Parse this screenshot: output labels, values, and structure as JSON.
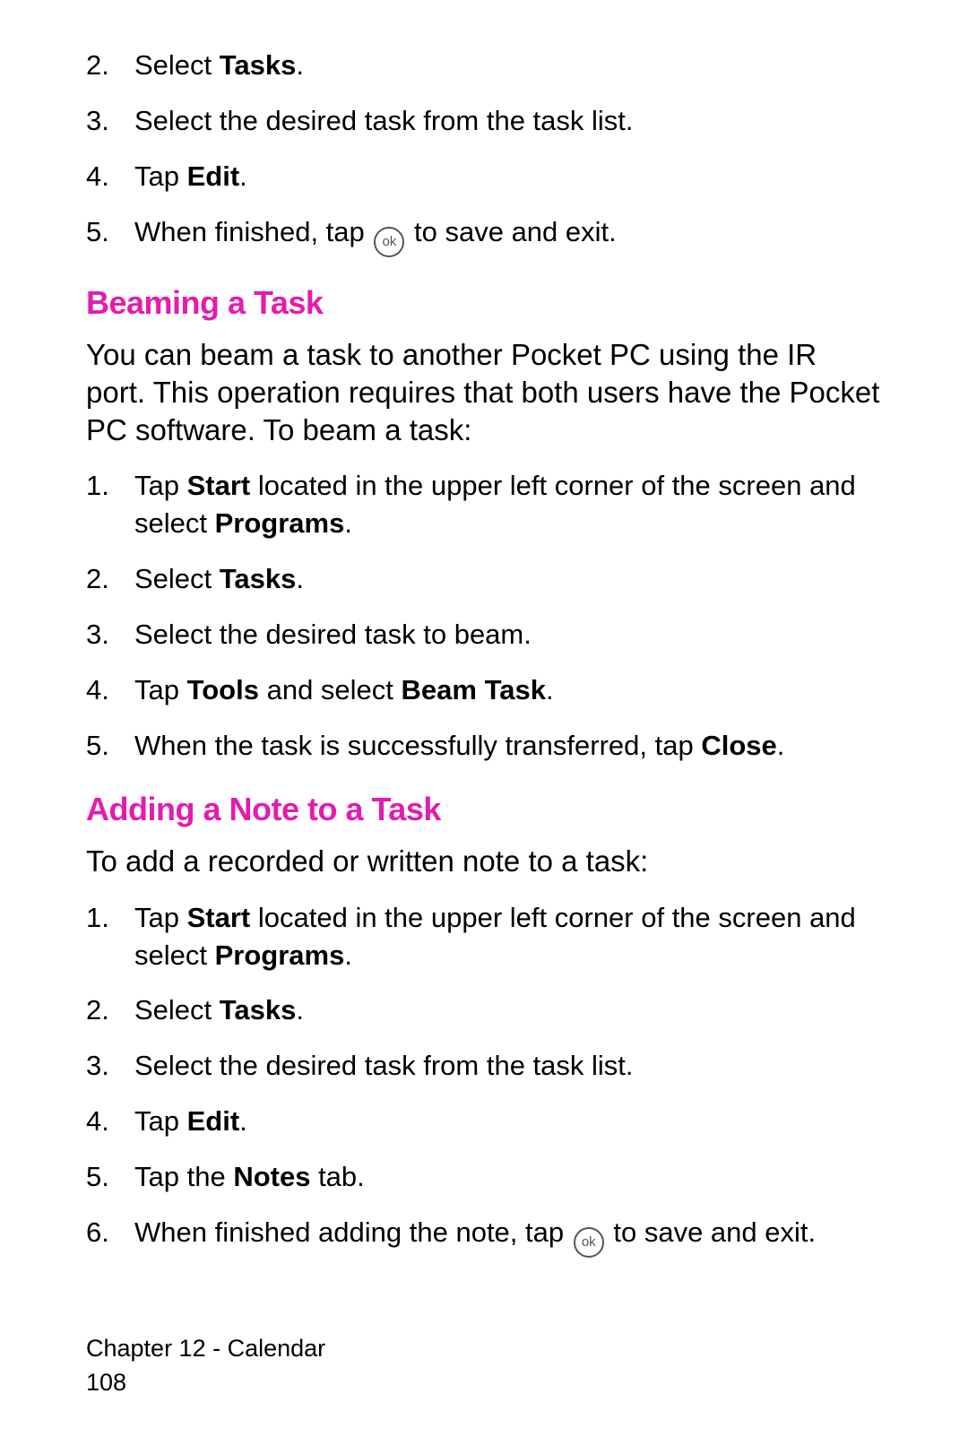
{
  "top_steps": [
    {
      "num": "2.",
      "parts": [
        {
          "t": "Select "
        },
        {
          "t": "Tasks",
          "b": true
        },
        {
          "t": "."
        }
      ]
    },
    {
      "num": "3.",
      "parts": [
        {
          "t": "Select the desired task from the task list."
        }
      ]
    },
    {
      "num": "4.",
      "parts": [
        {
          "t": "Tap "
        },
        {
          "t": "Edit",
          "b": true
        },
        {
          "t": "."
        }
      ]
    },
    {
      "num": "5.",
      "parts": [
        {
          "t": "When finished, tap "
        },
        {
          "icon": "ok"
        },
        {
          "t": " to save and exit."
        }
      ]
    }
  ],
  "section1": {
    "heading": "Beaming a Task",
    "intro": "You can beam a task to another Pocket PC using the IR port. This operation requires that both users have the Pocket PC software. To beam a task:",
    "steps": [
      {
        "num": "1.",
        "parts": [
          {
            "t": "Tap "
          },
          {
            "t": "Start",
            "b": true
          },
          {
            "t": " located in the upper left corner of the screen and select "
          },
          {
            "t": "Programs",
            "b": true
          },
          {
            "t": "."
          }
        ]
      },
      {
        "num": "2.",
        "parts": [
          {
            "t": "Select "
          },
          {
            "t": "Tasks",
            "b": true
          },
          {
            "t": "."
          }
        ]
      },
      {
        "num": "3.",
        "parts": [
          {
            "t": "Select the desired task to beam."
          }
        ]
      },
      {
        "num": "4.",
        "parts": [
          {
            "t": "Tap "
          },
          {
            "t": "Tools",
            "b": true
          },
          {
            "t": " and select "
          },
          {
            "t": "Beam Task",
            "b": true
          },
          {
            "t": "."
          }
        ]
      },
      {
        "num": "5.",
        "parts": [
          {
            "t": "When the task is successfully transferred, tap "
          },
          {
            "t": "Close",
            "b": true
          },
          {
            "t": "."
          }
        ]
      }
    ]
  },
  "section2": {
    "heading": "Adding a Note to a Task",
    "intro": "To add a recorded or written note to a task:",
    "steps": [
      {
        "num": "1.",
        "parts": [
          {
            "t": "Tap "
          },
          {
            "t": "Start",
            "b": true
          },
          {
            "t": " located in the upper left corner of the screen and select "
          },
          {
            "t": "Programs",
            "b": true
          },
          {
            "t": "."
          }
        ]
      },
      {
        "num": "2.",
        "parts": [
          {
            "t": "Select "
          },
          {
            "t": "Tasks",
            "b": true
          },
          {
            "t": "."
          }
        ]
      },
      {
        "num": "3.",
        "parts": [
          {
            "t": "Select the desired task from the task list."
          }
        ]
      },
      {
        "num": "4.",
        "parts": [
          {
            "t": "Tap "
          },
          {
            "t": "Edit",
            "b": true
          },
          {
            "t": "."
          }
        ]
      },
      {
        "num": "5.",
        "parts": [
          {
            "t": "Tap the "
          },
          {
            "t": "Notes",
            "b": true
          },
          {
            "t": " tab."
          }
        ]
      },
      {
        "num": "6.",
        "parts": [
          {
            "t": "When finished adding the note, tap "
          },
          {
            "icon": "ok"
          },
          {
            "t": " to save and exit."
          }
        ]
      }
    ]
  },
  "footer": {
    "chapter": "Chapter 12 - Calendar",
    "page": "108"
  },
  "ok_label": "ok"
}
